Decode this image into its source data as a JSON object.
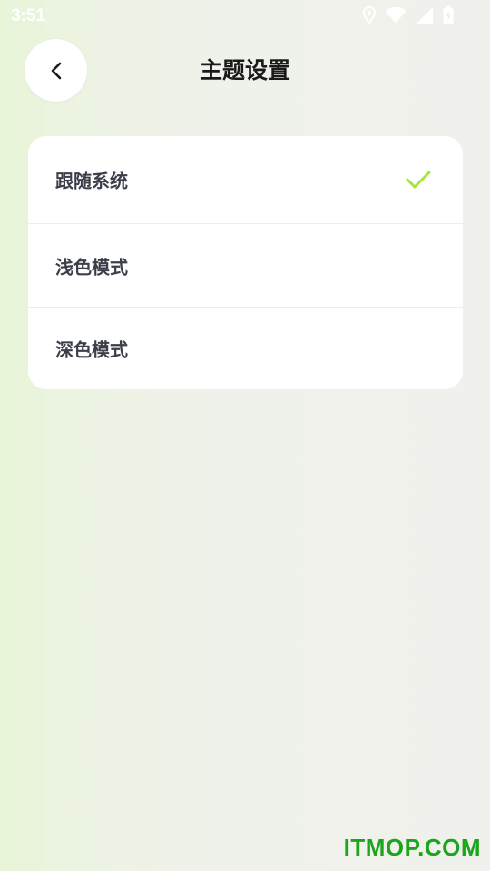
{
  "status_bar": {
    "time": "3:51",
    "icons": [
      "location-icon",
      "wifi-icon",
      "cell-signal-icon",
      "battery-icon"
    ]
  },
  "header": {
    "back_icon": "chevron-left-icon",
    "title": "主题设置"
  },
  "options": [
    {
      "label": "跟随系统",
      "selected": true
    },
    {
      "label": "浅色模式",
      "selected": false
    },
    {
      "label": "深色模式",
      "selected": false
    }
  ],
  "colors": {
    "accent_check": "#a6e636",
    "watermark": "#1aa51a"
  },
  "watermark": "ITMOP.COM"
}
